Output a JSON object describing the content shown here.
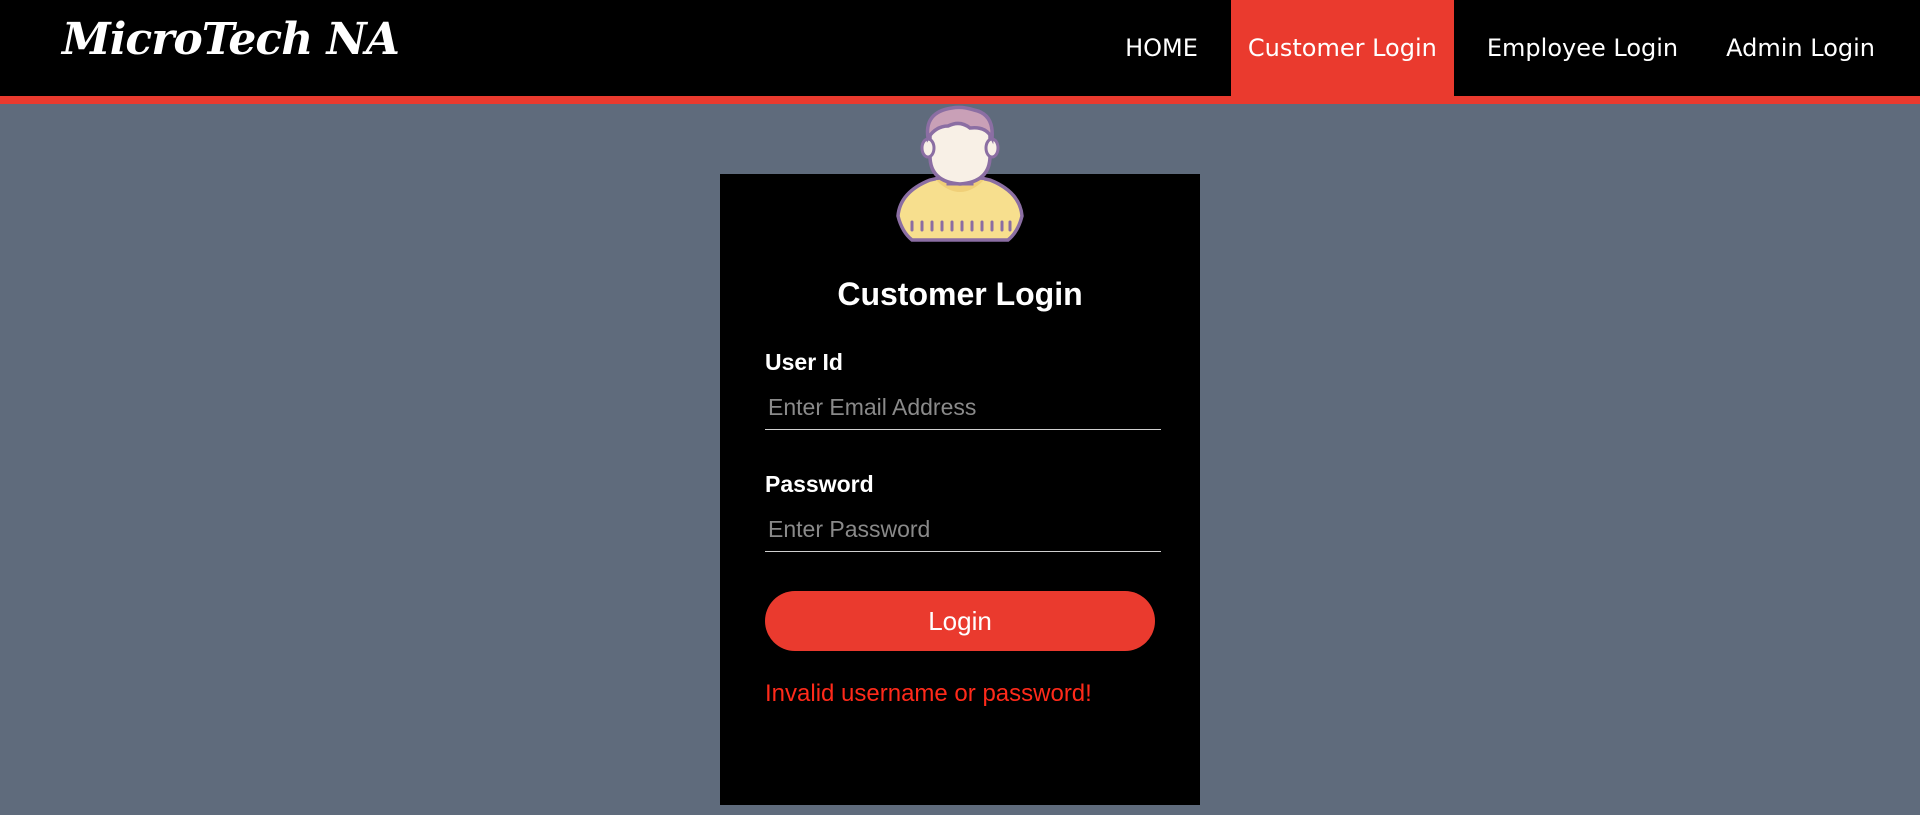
{
  "header": {
    "brand": "MicroTech NA",
    "nav": {
      "home": "HOME",
      "customer_login": "Customer Login",
      "employee_login": "Employee Login",
      "admin_login": "Admin Login"
    },
    "active_item": "customer_login",
    "accent_color": "#ea3a2e"
  },
  "login_form": {
    "avatar_icon": "user-avatar-icon",
    "title": "Customer Login",
    "user_id": {
      "label": "User Id",
      "value": "",
      "placeholder": "Enter Email Address"
    },
    "password": {
      "label": "Password",
      "value": "",
      "placeholder": "Enter Password"
    },
    "submit_label": "Login",
    "error_message": "Invalid username or password!"
  },
  "colors": {
    "background": "#5f6b7c",
    "card": "#000000",
    "error": "#ff2a1a"
  }
}
